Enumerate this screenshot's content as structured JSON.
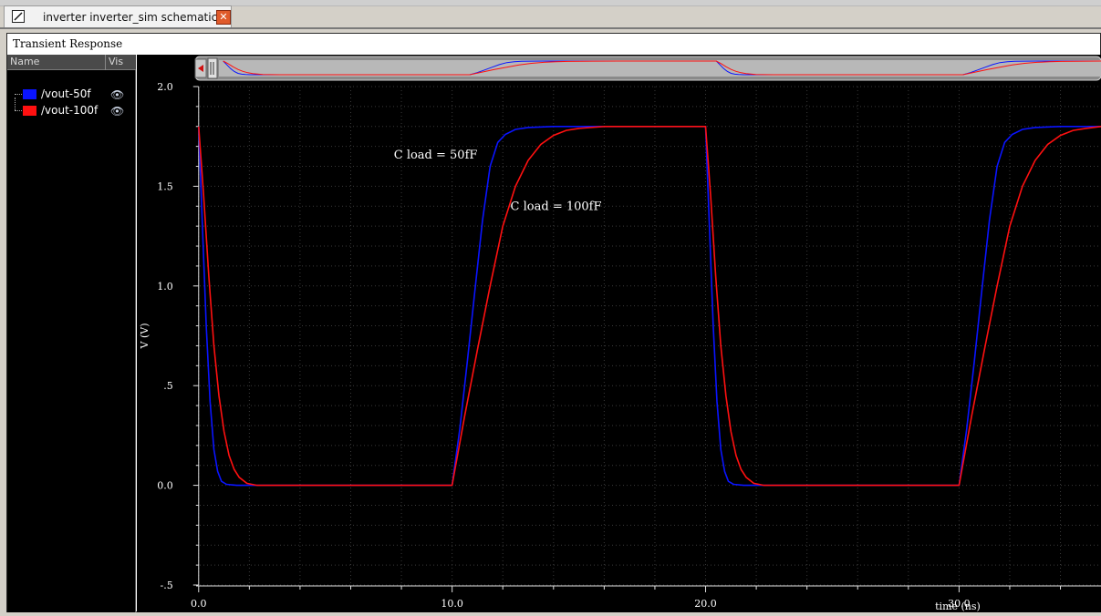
{
  "tab": {
    "title": "inverter inverter_sim schematic",
    "close_glyph": "✕",
    "icon": "schematic-icon"
  },
  "window": {
    "title": "Transient Response"
  },
  "signal_list": {
    "headers": {
      "name": "Name",
      "vis": "Vis"
    },
    "items": [
      {
        "label": "/vout-50f",
        "color": "#0a14ff",
        "visible": true
      },
      {
        "label": "/vout-100f",
        "color": "#ff1010",
        "visible": true
      }
    ]
  },
  "annotations": [
    {
      "text": "C load = 50fF",
      "x": 7.7,
      "y": 1.64
    },
    {
      "text": "C load = 100fF",
      "x": 12.3,
      "y": 1.38
    }
  ],
  "chart_data": {
    "type": "line",
    "xlabel": "time (ns)",
    "ylabel": "V (V)",
    "xlim": [
      -0.1,
      35.6
    ],
    "ylim": [
      -0.5,
      2.0
    ],
    "x_ticks": [
      0,
      10,
      20,
      30
    ],
    "x_tick_labels": [
      "0.0",
      "10.0",
      "20.0",
      "30.0"
    ],
    "y_ticks": [
      2.0,
      1.5,
      1.0,
      0.5,
      0.0,
      -0.5
    ],
    "y_tick_labels": [
      "2.0",
      "1.5",
      "1.0",
      ".5",
      "0.0",
      "-.5"
    ],
    "grid": true,
    "series": [
      {
        "name": "/vout-50f",
        "color": "#0a14ff",
        "x": [
          0,
          0.15,
          0.3,
          0.45,
          0.6,
          0.75,
          0.9,
          1.1,
          1.5,
          10,
          10.3,
          10.6,
          10.9,
          11.2,
          11.5,
          11.8,
          12.1,
          12.5,
          13,
          14,
          15,
          20,
          20.15,
          20.3,
          20.45,
          20.6,
          20.75,
          20.9,
          21.1,
          21.5,
          30,
          30.3,
          30.6,
          30.9,
          31.2,
          31.5,
          31.8,
          32.1,
          32.5,
          33,
          34,
          35.6
        ],
        "y": [
          1.8,
          1.3,
          0.8,
          0.42,
          0.18,
          0.07,
          0.02,
          0.005,
          0,
          0,
          0.28,
          0.62,
          0.98,
          1.33,
          1.6,
          1.72,
          1.76,
          1.785,
          1.795,
          1.8,
          1.8,
          1.8,
          1.3,
          0.8,
          0.42,
          0.18,
          0.07,
          0.02,
          0.005,
          0,
          0,
          0.28,
          0.62,
          0.98,
          1.33,
          1.6,
          1.72,
          1.76,
          1.785,
          1.795,
          1.8,
          1.8
        ]
      },
      {
        "name": "/vout-100f",
        "color": "#ff1010",
        "x": [
          0,
          0.2,
          0.4,
          0.6,
          0.8,
          1.0,
          1.2,
          1.4,
          1.6,
          1.9,
          2.3,
          10,
          10.5,
          11,
          11.5,
          12,
          12.5,
          13,
          13.5,
          14,
          14.5,
          15,
          16,
          17,
          20,
          20.2,
          20.4,
          20.6,
          20.8,
          21.0,
          21.2,
          21.4,
          21.6,
          21.9,
          22.3,
          30,
          30.5,
          31,
          31.5,
          32,
          32.5,
          33,
          33.5,
          34,
          34.5,
          35,
          35.6
        ],
        "y": [
          1.8,
          1.45,
          1.05,
          0.7,
          0.45,
          0.27,
          0.15,
          0.08,
          0.04,
          0.01,
          0,
          0,
          0.35,
          0.68,
          1.0,
          1.3,
          1.5,
          1.63,
          1.71,
          1.755,
          1.78,
          1.79,
          1.8,
          1.8,
          1.8,
          1.45,
          1.05,
          0.7,
          0.45,
          0.27,
          0.15,
          0.08,
          0.04,
          0.01,
          0,
          0,
          0.35,
          0.68,
          1.0,
          1.3,
          1.5,
          1.63,
          1.71,
          1.755,
          1.78,
          1.79,
          1.8
        ]
      }
    ]
  }
}
